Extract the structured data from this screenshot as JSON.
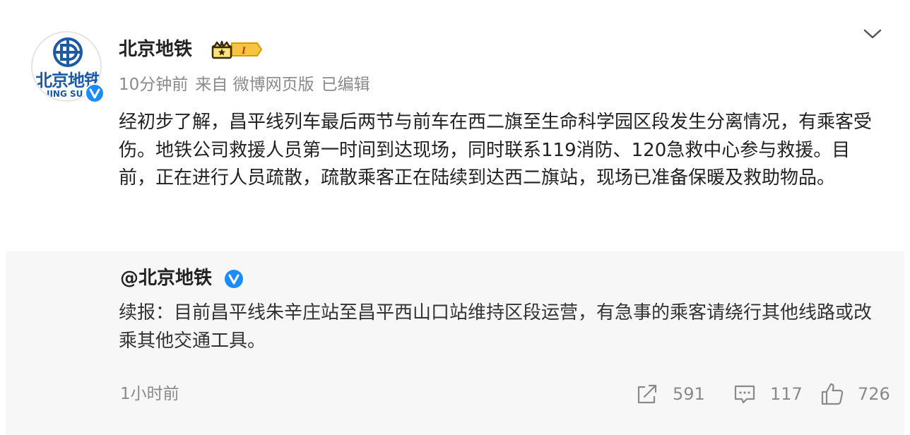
{
  "avatar": {
    "cn_text": "北京地铁",
    "en_text": "JING SU"
  },
  "header": {
    "username": "北京地铁",
    "badge_text": "I",
    "meta": {
      "time": "10分钟前",
      "source": "来自 微博网页版",
      "edited": "已编辑"
    }
  },
  "post": {
    "text": "经初步了解，昌平线列车最后两节与前车在西二旗至生命科学园区段发生分离情况，有乘客受伤。地铁公司救援人员第一时间到达现场，同时联系119消防、120急救中心参与救援。目前，正在进行人员疏散，疏散乘客正在陆续到达西二旗站，现场已准备保暖及救助物品。"
  },
  "repost": {
    "author": "@北京地铁",
    "text": "续报：目前昌平线朱辛庄站至昌平西山口站维持区段运营，有急事的乘客请绕行其他线路或改乘其他交通工具。",
    "time": "1小时前",
    "actions": {
      "repost_count": "591",
      "comment_count": "117",
      "like_count": "726"
    }
  },
  "colors": {
    "brand_blue": "#1a5aa6",
    "verified_blue": "#1a8cff",
    "gold": "#f5b800",
    "muted_text": "#8a8a8a",
    "repost_bg": "#f7f7f7"
  },
  "icons": {
    "avatar_logo": "beijing-subway-logo-icon",
    "verified": "verified-check-icon",
    "crown": "crown-level-badge-icon",
    "dropdown": "chevron-down-icon",
    "repost": "repost-icon",
    "comment": "comment-icon",
    "like": "thumbs-up-icon"
  }
}
